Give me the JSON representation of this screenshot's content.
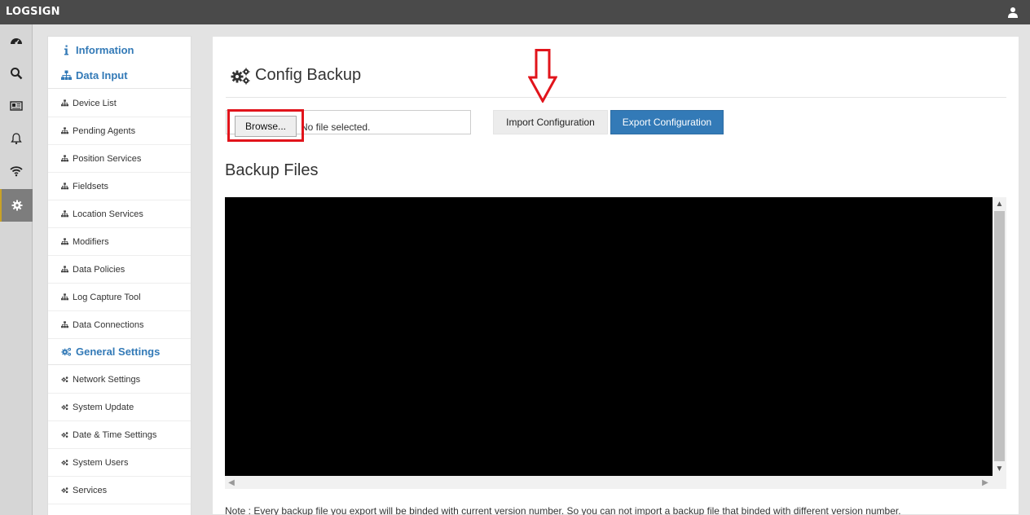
{
  "topbar": {
    "logo": "LOGSIGN",
    "user_icon": "user-icon"
  },
  "rail": {
    "items": [
      {
        "icon": "dashboard-icon"
      },
      {
        "icon": "search-icon"
      },
      {
        "icon": "news-icon"
      },
      {
        "icon": "bell-icon"
      },
      {
        "icon": "wifi-icon"
      },
      {
        "icon": "gear-icon",
        "active": true
      }
    ]
  },
  "sidenav": {
    "information": "Information",
    "data_input": {
      "title": "Data Input",
      "items": [
        "Device List",
        "Pending Agents",
        "Position Services",
        "Fieldsets",
        "Location Services",
        "Modifiers",
        "Data Policies",
        "Log Capture Tool",
        "Data Connections"
      ]
    },
    "general_settings": {
      "title": "General Settings",
      "items": [
        "Network Settings",
        "System Update",
        "Date & Time Settings",
        "System Users",
        "Services"
      ]
    }
  },
  "main": {
    "title": "Config Backup",
    "browse_label": "Browse...",
    "file_status": "No file selected.",
    "import_label": "Import Configuration",
    "export_label": "Export Configuration",
    "backup_title": "Backup Files",
    "note": "Note : Every backup file you export will be binded with current version number. So you can not import a backup file that binded with different version number."
  },
  "colors": {
    "accent": "#337ab7",
    "topbar": "#4a4a4a",
    "annotation": "#e1141b"
  }
}
